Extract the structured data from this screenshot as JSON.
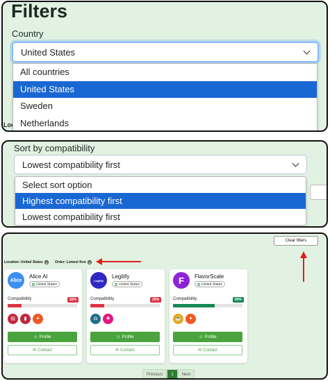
{
  "panel1": {
    "heading": "Filters",
    "label": "Country",
    "selected": "United States",
    "options": [
      "All countries",
      "United States",
      "Sweden",
      "Netherlands"
    ],
    "selected_index": 1,
    "behind_text": "Loc"
  },
  "panel2": {
    "label": "Sort by compatibility",
    "selected": "Lowest compatibility first",
    "options": [
      "Select sort option",
      "Highest compatibility first",
      "Lowest compatibility first"
    ],
    "selected_index": 1
  },
  "panel3": {
    "clear_filters": "Clear filters",
    "chips": [
      {
        "label": "Location: United States",
        "remove": "⊗"
      },
      {
        "label": "Order: Lowest first",
        "remove": "⊗"
      }
    ],
    "compat_label": "Compatibility",
    "profile_label": "Profile",
    "contact_label": "Contact",
    "cards": [
      {
        "name": "Alice AI",
        "logo_text": "Alice",
        "logo_color": "#3d8ef0",
        "location": "United States",
        "compatibility": "20%",
        "compat_value": 20,
        "badge_color": "#dc3545",
        "bar_color": "#dc3545",
        "icons": [
          {
            "name": "book-icon",
            "color": "#c0283c",
            "glyph": "▤"
          },
          {
            "name": "bar-chart-icon",
            "color": "#c0283c",
            "glyph": "▮"
          },
          {
            "name": "network-icon",
            "color": "#ee5a24",
            "glyph": "✦"
          }
        ]
      },
      {
        "name": "Legitify",
        "logo_text": "Legitify",
        "logo_color": "#2f27c4",
        "location": "United States",
        "compatibility": "20%",
        "compat_value": 20,
        "badge_color": "#dc3545",
        "bar_color": "#dc3545",
        "icons": [
          {
            "name": "scale-icon",
            "color": "#1f6f8b",
            "glyph": "⚖"
          },
          {
            "name": "compass-icon",
            "color": "#e6147f",
            "glyph": "✚"
          }
        ]
      },
      {
        "name": "FlavorScale",
        "logo_text": "F",
        "logo_color": "#8e24d8",
        "location": "United States",
        "compatibility": "60%",
        "compat_value": 60,
        "badge_color": "#198754",
        "bar_color": "#198754",
        "icons": [
          {
            "name": "food-icon",
            "color": "#e6a817",
            "glyph": "☕"
          },
          {
            "name": "network-icon",
            "color": "#ee5a24",
            "glyph": "✦"
          }
        ]
      }
    ],
    "pagination": {
      "previous": "Previous",
      "current": "1",
      "next": "Next"
    }
  },
  "colors": {
    "accent_red": "#e11d1d",
    "select_blue": "#1967d2",
    "primary_green": "#4aa43d"
  }
}
